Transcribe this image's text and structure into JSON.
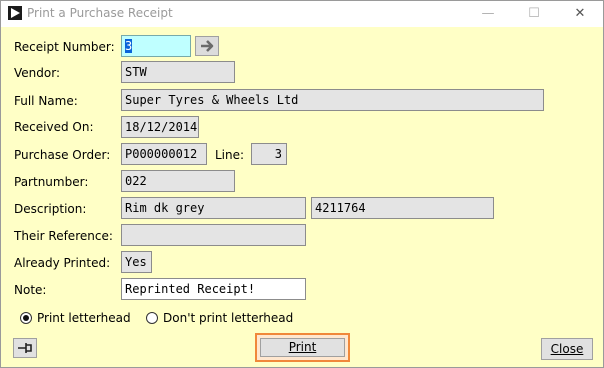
{
  "window": {
    "title": "Print a Purchase Receipt",
    "controls": {
      "minimize": "—",
      "maximize": "☐",
      "close": "✕"
    }
  },
  "labels": {
    "receipt_number": "Receipt Number:",
    "vendor": "Vendor:",
    "full_name": "Full Name:",
    "received_on": "Received On:",
    "purchase_order": "Purchase Order:",
    "line": "Line:",
    "partnumber": "Partnumber:",
    "description": "Description:",
    "their_reference": "Their Reference:",
    "already_printed": "Already Printed:",
    "note": "Note:"
  },
  "fields": {
    "receipt_number": "3",
    "vendor": "STW",
    "full_name": "Super Tyres & Wheels Ltd",
    "received_on": "18/12/2014",
    "purchase_order": "P000000012",
    "line": "3",
    "partnumber": "022",
    "description": "Rim dk grey",
    "description_code": "4211764",
    "their_reference": "",
    "already_printed": "Yes",
    "note": "Reprinted Receipt!"
  },
  "options": {
    "print_letterhead": "Print letterhead",
    "dont_print_letterhead": "Don't print letterhead",
    "selected": "print_letterhead"
  },
  "buttons": {
    "print": "Print",
    "close": "Close"
  },
  "icons": {
    "app": "play-arrow-icon",
    "go": "arrow-right-icon",
    "pin": "pin-icon"
  }
}
